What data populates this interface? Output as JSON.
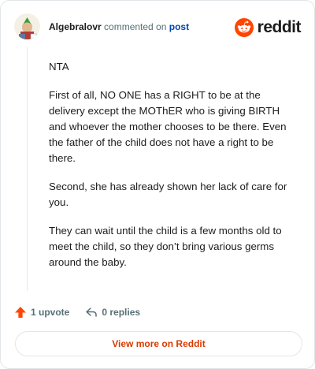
{
  "comment": {
    "username": "Algebralovr",
    "verb": "commented on",
    "post_link": "post",
    "paragraphs": [
      "NTA",
      "First of all, NO ONE has a RIGHT to be at the delivery except the MOThER who is giving BIRTH and whoever the mother chooses to be there. Even the father of the child does not have a right to be there.",
      "Second, she has already shown her lack of care for you.",
      "They can wait until the child is a few months old to meet the child, so they don’t bring various germs around the baby."
    ],
    "upvotes": "1 upvote",
    "replies": "0 replies"
  },
  "brand": {
    "logo_text": "reddit",
    "accent": "#ff4500"
  },
  "footer": {
    "view_more": "View more on Reddit"
  },
  "icons": [
    "avatar",
    "reddit-logo-icon",
    "upvote-arrow-icon",
    "reply-icon"
  ]
}
